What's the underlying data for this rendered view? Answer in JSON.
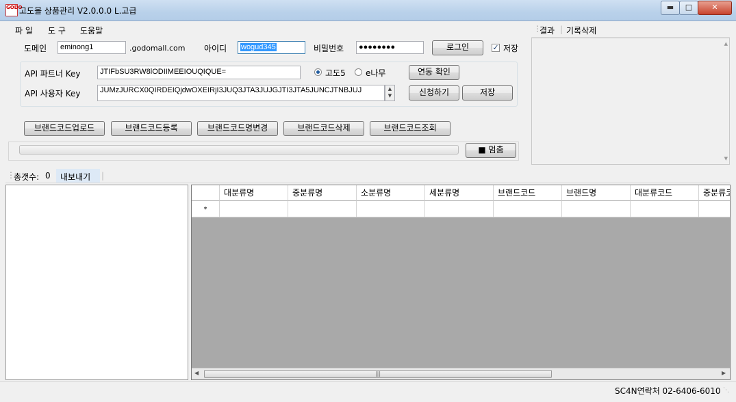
{
  "window": {
    "title": "고도몰 상품관리 V2.0.0.0 L.고급",
    "icon_text": "GODO"
  },
  "menu": {
    "file": "파 일",
    "tools": "도 구",
    "help": "도움말"
  },
  "login": {
    "domain_label": "도메인",
    "domain_value": "eminong1",
    "domain_suffix": ".godomall.com",
    "id_label": "아이디",
    "id_value": "wogud345",
    "password_label": "비밀번호",
    "password_value": "●●●●●●●●",
    "login_button": "로그인",
    "save_check_label": "저장",
    "save_checked": true
  },
  "api": {
    "partner_key_label": "API 파트너 Key",
    "partner_key_value": "JTIFbSU3RW8lODIIMEEIOUQIQUE=",
    "user_key_label": "API 사용자 Key",
    "user_key_value": "JUMzJURCX0QIRDEIQjdwOXEIRjI3JUQ3JTA3JUJGJTI3JTA5JUNCJTNBJUJ",
    "radio_godo5": "고도5",
    "radio_enamu": "e나무",
    "selected": "고도5",
    "link_check_button": "연동 확인",
    "apply_button": "신청하기",
    "save_button": "저장"
  },
  "actions": [
    "브랜드코드업로드",
    "브랜드코드등록",
    "브랜드코드명변경",
    "브랜드코드삭제",
    "브랜드코드조회"
  ],
  "progress": {
    "value": 0,
    "stop_button": "■ 멈춤"
  },
  "results_toolbar": {
    "result": "결과",
    "delete_log": "기록삭제"
  },
  "count_toolbar": {
    "total_label": "총갯수:",
    "total_value": "0",
    "export": "내보내기"
  },
  "grid": {
    "columns": [
      "대분류명",
      "중분류명",
      "소분류명",
      "세분류명",
      "브랜드코드",
      "브랜드명",
      "대분류코드",
      "중분류코"
    ],
    "new_row_marker": "*"
  },
  "status": {
    "contact": "SC4N연락처 02-6406-6010"
  }
}
